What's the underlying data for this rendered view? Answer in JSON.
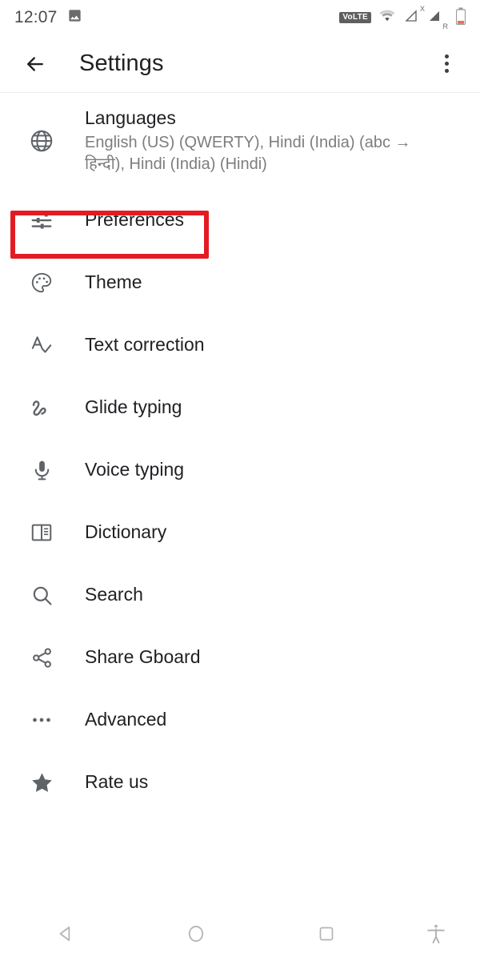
{
  "status_bar": {
    "clock": "12:07",
    "image_icon": "image-icon",
    "volte_label": "VoLTE",
    "wifi_icon": "wifi-icon",
    "signal_icon": "signal-icon",
    "signal_sup_label": "X",
    "signal_sub_label": "R",
    "battery_icon": "battery-icon"
  },
  "app_bar": {
    "back_icon": "back-arrow-icon",
    "title": "Settings",
    "overflow_icon": "overflow-menu-icon"
  },
  "settings_list": [
    {
      "id": "languages",
      "icon": "globe-icon",
      "title": "Languages",
      "summary": "English (US) (QWERTY), Hindi (India) (abc → हिन्दी), Hindi (India) (Hindi)"
    },
    {
      "id": "preferences",
      "icon": "tune-sliders-icon",
      "title": "Preferences"
    },
    {
      "id": "theme",
      "icon": "palette-icon",
      "title": "Theme"
    },
    {
      "id": "text-correction",
      "icon": "spellcheck-icon",
      "title": "Text correction"
    },
    {
      "id": "glide-typing",
      "icon": "gesture-icon",
      "title": "Glide typing"
    },
    {
      "id": "voice-typing",
      "icon": "microphone-icon",
      "title": "Voice typing"
    },
    {
      "id": "dictionary",
      "icon": "book-icon",
      "title": "Dictionary"
    },
    {
      "id": "search",
      "icon": "search-icon",
      "title": "Search"
    },
    {
      "id": "share-gboard",
      "icon": "share-icon",
      "title": "Share Gboard"
    },
    {
      "id": "advanced",
      "icon": "more-horizontal-icon",
      "title": "Advanced"
    },
    {
      "id": "rate-us",
      "icon": "star-icon",
      "title": "Rate us"
    }
  ],
  "annotation": {
    "target": "preferences",
    "color": "#E31B23"
  },
  "nav_bar": {
    "back_icon": "nav-back-triangle-icon",
    "home_icon": "nav-home-circle-icon",
    "recents_icon": "nav-recents-square-icon",
    "accessibility_icon": "accessibility-icon"
  }
}
